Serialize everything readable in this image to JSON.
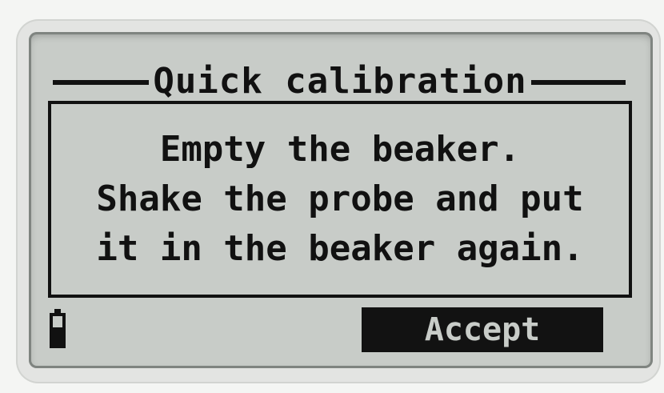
{
  "screen": {
    "title": "Quick calibration",
    "message_lines": [
      "Empty the beaker.",
      "Shake the probe and put",
      "it in the beaker again."
    ],
    "status": {
      "battery_icon": "battery-icon"
    },
    "softkey": {
      "accept_label": "Accept"
    }
  },
  "colors": {
    "lcd_background": "#c8ccc8",
    "lcd_ink": "#111111"
  }
}
